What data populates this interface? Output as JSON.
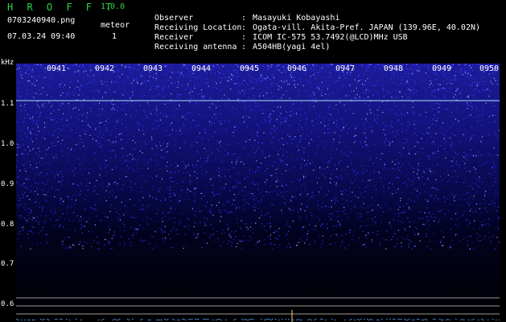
{
  "header": {
    "app_title": "H R O F F T",
    "app_version": "1.0.0",
    "file_name": "0703240940.png",
    "datetime": "07.03.24 09:40",
    "meteor_label": "meteor",
    "meteor_count": "1"
  },
  "info": [
    {
      "key": "Observer",
      "sep": ":",
      "value": "Masayuki Kobayashi"
    },
    {
      "key": "Receiving Location",
      "sep": ":",
      "value": "Ogata-vill. Akita-Pref. JAPAN (139.96E, 40.02N)"
    },
    {
      "key": "Receiver",
      "sep": ":",
      "value": "ICOM IC-575 53.7492(@LCD)MHz USB"
    },
    {
      "key": "Receiving antenna",
      "sep": ":",
      "value": "A504HB(yagi 4el)"
    }
  ],
  "spectrogram": {
    "y_unit": "kHz",
    "y_ticks": [
      "1.1",
      "1.0",
      "0.9",
      "0.8",
      "0.7",
      "0.6"
    ],
    "x_ticks": [
      "0941",
      "0942",
      "0943",
      "0944",
      "0945",
      "0946",
      "0947",
      "0948",
      "0949",
      "0950"
    ],
    "colors": {
      "noise_high": "#3a3aff",
      "noise_low": "#0a0a5a",
      "carrier_line": "#b0e0ff",
      "ref_lines": "#9a9a9a",
      "bottom_trace": "#4aa0ff"
    }
  }
}
